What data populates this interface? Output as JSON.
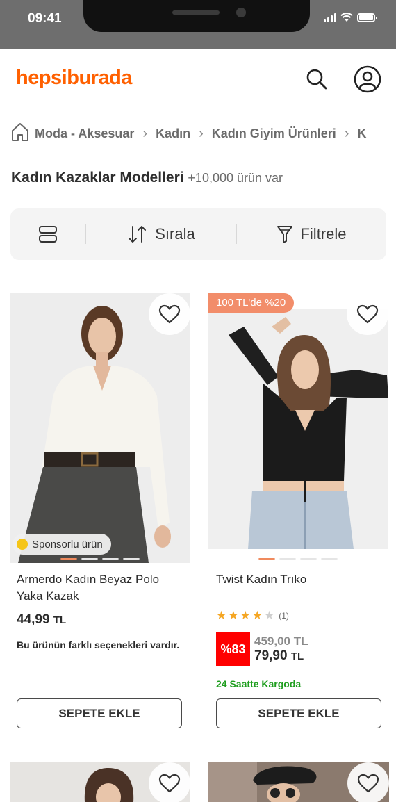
{
  "status_bar": {
    "time": "09:41"
  },
  "header": {
    "logo": "hepsiburada",
    "search_icon": "search-icon",
    "account_icon": "user-icon",
    "brand_color": "#ff6000"
  },
  "breadcrumb": {
    "home_icon": "home-icon",
    "items": [
      "Moda - Aksesuar",
      "Kadın",
      "Kadın Giyim Ürünleri",
      "K"
    ]
  },
  "listing": {
    "title": "Kadın Kazaklar Modelleri",
    "count": "+10,000 ürün var"
  },
  "toolbar": {
    "view_icon": "grid-view-icon",
    "sort_label": "Sırala",
    "sort_icon": "sort-icon",
    "filter_label": "Filtrele",
    "filter_icon": "filter-icon"
  },
  "products": [
    {
      "name": "Armerdo Kadın Beyaz Polo Yaka Kazak",
      "price": "44,99",
      "currency": "TL",
      "sponsor_label": "Sponsorlu ürün",
      "variants_note": "Bu ürünün farklı seçenekleri vardır.",
      "cart_label": "SEPETE EKLE",
      "image_slides": 4,
      "active_slide": 1
    },
    {
      "name": "Twist Kadın Trıko",
      "promo": "100 TL'de %20",
      "rating": 4,
      "rating_max": 5,
      "review_count": "(1)",
      "discount_badge": "%83",
      "old_price": "459,00 TL",
      "price": "79,90",
      "currency": "TL",
      "shipping": "24 Saatte Kargoda",
      "cart_label": "SEPETE EKLE",
      "image_slides": 4,
      "active_slide": 1
    }
  ],
  "colors": {
    "promo_badge": "#f28d6a",
    "discount": "#ff0000",
    "shipping": "#1f9e1f",
    "star": "#f5a623"
  }
}
